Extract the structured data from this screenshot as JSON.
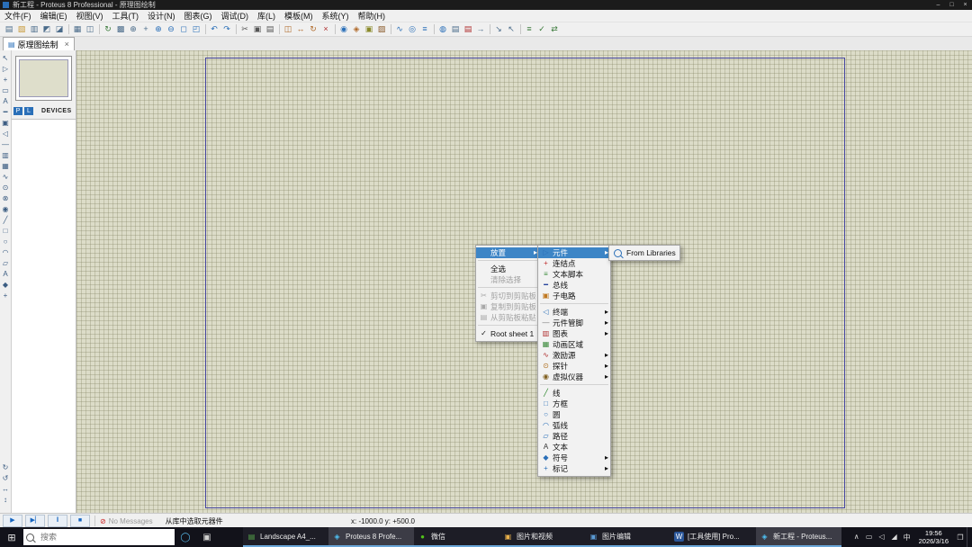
{
  "titlebar": {
    "title": "新工程 - Proteus 8 Professional - 原理图绘制",
    "controls": {
      "minimize": "–",
      "maximize": "□",
      "close": "×"
    }
  },
  "menubar": {
    "items": [
      "文件(F)",
      "编辑(E)",
      "视图(V)",
      "工具(T)",
      "设计(N)",
      "图表(G)",
      "调试(D)",
      "库(L)",
      "模板(M)",
      "系统(Y)",
      "帮助(H)"
    ]
  },
  "toolbar": {
    "icons": [
      {
        "name": "new-project-icon",
        "glyph": "▤",
        "color": "#4a6b8a",
        "flags": []
      },
      {
        "name": "open-project-icon",
        "glyph": "▧",
        "color": "#c89a3a",
        "flags": []
      },
      {
        "name": "save-project-icon",
        "glyph": "▥",
        "color": "#4a6b8a",
        "flags": []
      },
      {
        "name": "import-section-icon",
        "glyph": "◩",
        "color": "#4a6b8a",
        "flags": []
      },
      {
        "name": "export-section-icon",
        "glyph": "◪",
        "color": "#4a6b8a",
        "flags": [
          "sep-after"
        ]
      },
      {
        "name": "print-icon",
        "glyph": "▦",
        "color": "#4a6b8a",
        "flags": []
      },
      {
        "name": "mark-output-area-icon",
        "glyph": "◫",
        "color": "#4a6b8a",
        "flags": [
          "sep-after"
        ]
      },
      {
        "name": "redraw-icon",
        "glyph": "↻",
        "color": "#3a7a3a",
        "flags": []
      },
      {
        "name": "toggle-grid-icon",
        "glyph": "▩",
        "color": "#4a6b8a",
        "flags": []
      },
      {
        "name": "false-origin-icon",
        "glyph": "⊕",
        "color": "#4a6b8a",
        "flags": []
      },
      {
        "name": "goto-cursor-icon",
        "glyph": "+",
        "color": "#4a6b8a",
        "flags": []
      },
      {
        "name": "zoom-in-icon",
        "glyph": "⊕",
        "color": "#2a6fb8",
        "flags": []
      },
      {
        "name": "zoom-out-icon",
        "glyph": "⊖",
        "color": "#2a6fb8",
        "flags": []
      },
      {
        "name": "zoom-all-icon",
        "glyph": "◻",
        "color": "#2a6fb8",
        "flags": []
      },
      {
        "name": "zoom-area-icon",
        "glyph": "◰",
        "color": "#2a6fb8",
        "flags": [
          "sep-after"
        ]
      },
      {
        "name": "undo-icon",
        "glyph": "↶",
        "color": "#2a6fb8",
        "flags": []
      },
      {
        "name": "redo-icon",
        "glyph": "↷",
        "color": "#2a6fb8",
        "flags": [
          "sep-after"
        ]
      },
      {
        "name": "cut-icon",
        "glyph": "✂",
        "color": "#555555",
        "flags": []
      },
      {
        "name": "copy-icon",
        "glyph": "▣",
        "color": "#555555",
        "flags": []
      },
      {
        "name": "paste-icon",
        "glyph": "▤",
        "color": "#555555",
        "flags": [
          "sep-after"
        ]
      },
      {
        "name": "block-copy-icon",
        "glyph": "◫",
        "color": "#b06a2a",
        "flags": []
      },
      {
        "name": "block-move-icon",
        "glyph": "↔",
        "color": "#b06a2a",
        "flags": []
      },
      {
        "name": "block-rotate-icon",
        "glyph": "↻",
        "color": "#b06a2a",
        "flags": []
      },
      {
        "name": "block-delete-icon",
        "glyph": "×",
        "color": "#b03030",
        "flags": [
          "sep-after"
        ]
      },
      {
        "name": "pick-parts-icon",
        "glyph": "◉",
        "color": "#2a6fb8",
        "flags": []
      },
      {
        "name": "make-device-icon",
        "glyph": "◈",
        "color": "#b06a2a",
        "flags": []
      },
      {
        "name": "packaging-tool-icon",
        "glyph": "▣",
        "color": "#8a8a2a",
        "flags": []
      },
      {
        "name": "decompose-icon",
        "glyph": "▨",
        "color": "#8a5a2a",
        "flags": [
          "sep-after"
        ]
      },
      {
        "name": "wire-autorouter-icon",
        "glyph": "∿",
        "color": "#2a6fb8",
        "flags": []
      },
      {
        "name": "search-tag-icon",
        "glyph": "◎",
        "color": "#2a6fb8",
        "flags": []
      },
      {
        "name": "property-assignment-icon",
        "glyph": "≡",
        "color": "#2a6fb8",
        "flags": [
          "sep-after"
        ]
      },
      {
        "name": "design-explorer-icon",
        "glyph": "◍",
        "color": "#2a6fb8",
        "flags": []
      },
      {
        "name": "new-sheet-icon",
        "glyph": "▤",
        "color": "#4a6b8a",
        "flags": []
      },
      {
        "name": "remove-sheet-icon",
        "glyph": "▤",
        "color": "#b03030",
        "flags": []
      },
      {
        "name": "goto-sheet-icon",
        "glyph": "→",
        "color": "#4a6b8a",
        "flags": [
          "sep-after"
        ]
      },
      {
        "name": "zoom-to-child-icon",
        "glyph": "↘",
        "color": "#4a6b8a",
        "flags": []
      },
      {
        "name": "return-to-parent-icon",
        "glyph": "↖",
        "color": "#4a6b8a",
        "flags": [
          "sep-after"
        ]
      },
      {
        "name": "bill-of-materials-icon",
        "glyph": "≡",
        "color": "#3a7a3a",
        "flags": []
      },
      {
        "name": "electrical-rules-check-icon",
        "glyph": "✓",
        "color": "#3a7a3a",
        "flags": []
      },
      {
        "name": "netlist-transfer-icon",
        "glyph": "⇄",
        "color": "#3a7a3a",
        "flags": []
      }
    ]
  },
  "tab": {
    "label": "原理图绘制",
    "close": "×"
  },
  "left_toolbar": {
    "icons": [
      {
        "name": "selection-mode-icon",
        "glyph": "↖"
      },
      {
        "name": "component-mode-icon",
        "glyph": "▷"
      },
      {
        "name": "junction-dot-mode-icon",
        "glyph": "+"
      },
      {
        "name": "wire-label-mode-icon",
        "glyph": "▭"
      },
      {
        "name": "text-script-mode-icon",
        "glyph": "A"
      },
      {
        "name": "bus-mode-icon",
        "glyph": "━"
      },
      {
        "name": "subcircuit-mode-icon",
        "glyph": "▣"
      },
      {
        "name": "terminal-mode-icon",
        "glyph": "◁"
      },
      {
        "name": "device-pin-mode-icon",
        "glyph": "—"
      },
      {
        "name": "graph-mode-icon",
        "glyph": "▥"
      },
      {
        "name": "tape-recorder-mode-icon",
        "glyph": "▦"
      },
      {
        "name": "generator-mode-icon",
        "glyph": "∿"
      },
      {
        "name": "voltage-probe-mode-icon",
        "glyph": "⊙"
      },
      {
        "name": "current-probe-mode-icon",
        "glyph": "⊗"
      },
      {
        "name": "virtual-instrument-mode-icon",
        "glyph": "◉"
      },
      {
        "name": "2d-line-mode-icon",
        "glyph": "╱"
      },
      {
        "name": "2d-box-mode-icon",
        "glyph": "□"
      },
      {
        "name": "2d-circle-mode-icon",
        "glyph": "○"
      },
      {
        "name": "2d-arc-mode-icon",
        "glyph": "◠"
      },
      {
        "name": "2d-path-mode-icon",
        "glyph": "▱"
      },
      {
        "name": "2d-text-mode-icon",
        "glyph": "A"
      },
      {
        "name": "2d-symbol-mode-icon",
        "glyph": "◆"
      },
      {
        "name": "2d-marker-mode-icon",
        "glyph": "+"
      }
    ],
    "rotate": [
      {
        "name": "rotate-clockwise-icon",
        "glyph": "↻"
      },
      {
        "name": "rotate-anticlockwise-icon",
        "glyph": "↺"
      },
      {
        "name": "x-mirror-icon",
        "glyph": "↔"
      },
      {
        "name": "y-mirror-icon",
        "glyph": "↕"
      }
    ]
  },
  "left_panel": {
    "p": "P",
    "l": "L",
    "devices": "DEVICES"
  },
  "context_menu": {
    "items": [
      {
        "label": "放置",
        "icon": "place-item",
        "glyph": "",
        "flags": [
          "highlighted",
          "has-submenu",
          "separator-after"
        ]
      },
      {
        "label": "全选",
        "icon": "select-all-item",
        "glyph": "",
        "flags": []
      },
      {
        "label": "清除选择",
        "icon": "clear-selection-item",
        "glyph": "",
        "flags": [
          "disabled",
          "separator-after"
        ]
      },
      {
        "label": "剪切到剪贴板",
        "icon": "cut-icon",
        "glyph": "✂",
        "color": "#a8a8a8",
        "flags": [
          "disabled"
        ]
      },
      {
        "label": "复制到剪贴板",
        "icon": "copy-icon",
        "glyph": "▣",
        "color": "#a8a8a8",
        "flags": [
          "disabled"
        ]
      },
      {
        "label": "从剪贴板粘贴",
        "icon": "paste-icon",
        "glyph": "▤",
        "color": "#a8a8a8",
        "flags": [
          "disabled",
          "separator-after"
        ]
      },
      {
        "label": "Root sheet 1",
        "icon": "check-icon",
        "glyph": "✓",
        "color": "#111111",
        "flags": []
      }
    ]
  },
  "place_menu": {
    "items": [
      {
        "label": "元件",
        "icon": "component-icon",
        "glyph": "▷",
        "color": "#2a6fb8",
        "flags": [
          "highlighted",
          "has-submenu"
        ]
      },
      {
        "label": "连结点",
        "icon": "junction-dot-icon",
        "glyph": "+",
        "color": "#c03030",
        "flags": []
      },
      {
        "label": "文本脚本",
        "icon": "text-script-icon",
        "glyph": "≡",
        "color": "#3a8a3a",
        "flags": []
      },
      {
        "label": "总线",
        "icon": "bus-icon",
        "glyph": "━",
        "color": "#23409a",
        "flags": []
      },
      {
        "label": "子电路",
        "icon": "subcircuit-icon",
        "glyph": "▣",
        "color": "#c07820",
        "flags": [
          "separator-after"
        ]
      },
      {
        "label": "终端",
        "icon": "terminal-icon",
        "glyph": "◁",
        "color": "#2a6fb8",
        "flags": [
          "has-submenu"
        ]
      },
      {
        "label": "元件管脚",
        "icon": "device-pin-icon",
        "glyph": "—",
        "color": "#777777",
        "flags": [
          "has-submenu"
        ]
      },
      {
        "label": "图表",
        "icon": "graph-icon",
        "glyph": "▥",
        "color": "#b03030",
        "flags": [
          "has-submenu"
        ]
      },
      {
        "label": "动画区域",
        "icon": "animation-region-icon",
        "glyph": "▦",
        "color": "#3a8a3a",
        "flags": []
      },
      {
        "label": "激励源",
        "icon": "generator-icon",
        "glyph": "∿",
        "color": "#b03030",
        "flags": [
          "has-submenu"
        ]
      },
      {
        "label": "探针",
        "icon": "probe-icon",
        "glyph": "⊙",
        "color": "#b07020",
        "flags": [
          "has-submenu"
        ]
      },
      {
        "label": "虚拟仪器",
        "icon": "virtual-instrument-icon",
        "glyph": "◉",
        "color": "#806020",
        "flags": [
          "has-submenu",
          "separator-after"
        ]
      },
      {
        "label": "线",
        "icon": "2d-line-icon",
        "glyph": "╱",
        "color": "#208020",
        "flags": []
      },
      {
        "label": "方框",
        "icon": "2d-box-icon",
        "glyph": "□",
        "color": "#2a6fb8",
        "flags": []
      },
      {
        "label": "圆",
        "icon": "2d-circle-icon",
        "glyph": "○",
        "color": "#2a6fb8",
        "flags": []
      },
      {
        "label": "弧线",
        "icon": "2d-arc-icon",
        "glyph": "◠",
        "color": "#2a6fb8",
        "flags": []
      },
      {
        "label": "路径",
        "icon": "2d-path-icon",
        "glyph": "▱",
        "color": "#2a6fb8",
        "flags": []
      },
      {
        "label": "文本",
        "icon": "2d-text-icon",
        "glyph": "A",
        "color": "#333333",
        "flags": []
      },
      {
        "label": "符号",
        "icon": "2d-symbol-icon",
        "glyph": "◆",
        "color": "#2a6fb8",
        "flags": [
          "has-submenu"
        ]
      },
      {
        "label": "标记",
        "icon": "2d-marker-icon",
        "glyph": "+",
        "color": "#2a6fb8",
        "flags": [
          "has-submenu"
        ]
      }
    ]
  },
  "library_menu": {
    "label": "From Libraries"
  },
  "statusbar": {
    "sim": [
      {
        "name": "play-button",
        "glyph": "▶"
      },
      {
        "name": "step-button",
        "glyph": "▶▏"
      },
      {
        "name": "pause-button",
        "glyph": "‖"
      },
      {
        "name": "stop-button",
        "glyph": "■"
      }
    ],
    "no_messages": "No Messages",
    "hint": "从库中选取元器件",
    "coords": "x:  -1000.0   y:  +500.0"
  },
  "taskbar": {
    "search_placeholder": "搜索",
    "apps": [
      {
        "label": "Landscape A4_...",
        "icon": "landscape-a4-icon",
        "glyph": "▤",
        "color": "#57a64a",
        "flags": [
          "open"
        ]
      },
      {
        "label": "Proteus 8 Profe...",
        "icon": "proteus-home-icon",
        "glyph": "◈",
        "color": "#4fc3f7",
        "flags": [
          "open",
          "active"
        ]
      },
      {
        "label": "微信",
        "icon": "wechat-icon",
        "glyph": "●",
        "color": "#52c41a",
        "flags": [
          "open"
        ]
      },
      {
        "label": "图片和视频",
        "icon": "photos-video-icon",
        "glyph": "▣",
        "color": "#e8b04a",
        "flags": [
          "open"
        ]
      },
      {
        "label": "图片编辑",
        "icon": "photo-editor-icon",
        "glyph": "▣",
        "color": "#5b9bd5",
        "flags": [
          "open"
        ]
      },
      {
        "label": "[工具使用] Pro...",
        "icon": "word-document-icon",
        "glyph": "W",
        "color": "#ffffff",
        "bg": "#2b579a",
        "flags": [
          "open"
        ]
      },
      {
        "label": "新工程 - Proteus...",
        "icon": "proteus-project-icon",
        "glyph": "◈",
        "color": "#4fc3f7",
        "flags": [
          "open",
          "active"
        ]
      }
    ],
    "tray": {
      "icons": [
        {
          "name": "hidden-icons-chevron",
          "glyph": "∧"
        },
        {
          "name": "display-icon",
          "glyph": "▭"
        },
        {
          "name": "volume-icon",
          "glyph": "◁"
        },
        {
          "name": "network-icon",
          "glyph": "◢"
        },
        {
          "name": "ime-language-indicator",
          "glyph": "中"
        }
      ],
      "time": "19:56",
      "date": "2026/3/16"
    }
  }
}
